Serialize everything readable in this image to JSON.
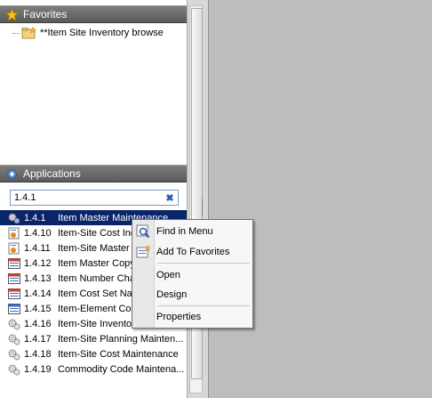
{
  "favorites": {
    "header": "Favorites",
    "items": [
      {
        "label": "**Item Site Inventory browse"
      }
    ]
  },
  "applications": {
    "header": "Applications",
    "search_value": "1.4.1",
    "rows": [
      {
        "code": "1.4.1",
        "name": "Item Master Maintenance"
      },
      {
        "code": "1.4.10",
        "name": "Item-Site Cost Inq"
      },
      {
        "code": "1.4.11",
        "name": "Item-Site Master I"
      },
      {
        "code": "1.4.12",
        "name": "Item Master Copy"
      },
      {
        "code": "1.4.13",
        "name": "Item Number Cha"
      },
      {
        "code": "1.4.14",
        "name": "Item Cost Set Nar"
      },
      {
        "code": "1.4.15",
        "name": "Item-Element Cos"
      },
      {
        "code": "1.4.16",
        "name": "Item-Site Inventor"
      },
      {
        "code": "1.4.17",
        "name": "Item-Site Planning Mainten..."
      },
      {
        "code": "1.4.18",
        "name": "Item-Site Cost Maintenance"
      },
      {
        "code": "1.4.19",
        "name": "Commodity Code Maintena..."
      }
    ]
  },
  "context_menu": {
    "find_in_menu": "Find in Menu",
    "add_to_favorites": "Add To Favorites",
    "open": "Open",
    "design": "Design",
    "properties": "Properties"
  },
  "colors": {
    "selection": "#0a246a",
    "header": "#6b6b6b",
    "workspace": "#bdbdbd"
  }
}
